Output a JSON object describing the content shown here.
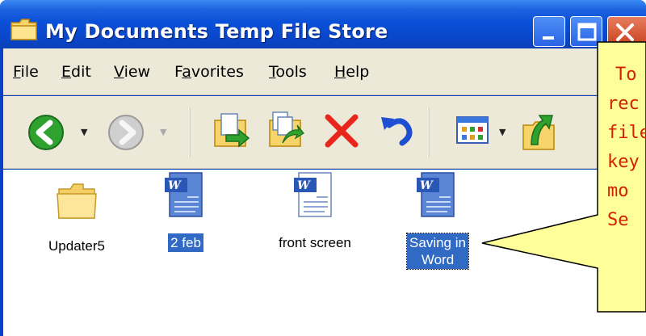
{
  "window": {
    "title": "My Documents Temp File Store",
    "colors": {
      "titlebar": "#0a50d8",
      "chrome": "#ece9d8",
      "selection": "#316ac5"
    }
  },
  "menubar": {
    "items": [
      {
        "label": "File",
        "accel": "F"
      },
      {
        "label": "Edit",
        "accel": "E"
      },
      {
        "label": "View",
        "accel": "V"
      },
      {
        "label": "Favorites",
        "accel": "a"
      },
      {
        "label": "Tools",
        "accel": "T"
      },
      {
        "label": "Help",
        "accel": "H"
      }
    ]
  },
  "toolbar": {
    "icons": [
      "back-icon",
      "forward-icon",
      "move-to-icon",
      "copy-to-icon",
      "delete-icon",
      "undo-icon",
      "views-icon",
      "up-folder-icon"
    ]
  },
  "files": [
    {
      "name": "Updater5",
      "type": "folder",
      "selected": false
    },
    {
      "name": "2 feb",
      "type": "word-doc",
      "selected": true
    },
    {
      "name": "front screen",
      "type": "word-doc",
      "selected": false
    },
    {
      "name": "Saving in\nWord",
      "line1": "Saving in",
      "line2": "Word",
      "type": "word-doc",
      "selected": true
    }
  ],
  "callout": {
    "lines": [
      "To",
      "rec",
      "file",
      "key",
      "mo",
      "Se"
    ],
    "color": "#ffff99",
    "text_color": "#d22000"
  }
}
